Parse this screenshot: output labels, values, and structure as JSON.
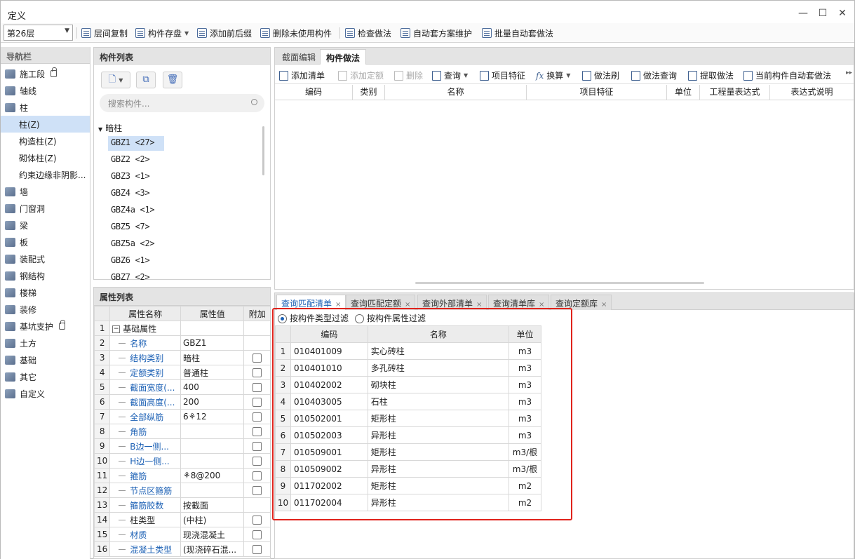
{
  "window": {
    "title": "定义"
  },
  "toolbar": {
    "floor": "第26层",
    "items": [
      {
        "label": "层间复制"
      },
      {
        "label": "构件存盘"
      },
      {
        "label": "添加前后缀"
      },
      {
        "label": "删除未使用构件"
      },
      {
        "label": "检查做法"
      },
      {
        "label": "自动套方案维护"
      },
      {
        "label": "批量自动套做法"
      }
    ]
  },
  "nav": {
    "title": "导航栏",
    "items": [
      {
        "label": "施工段",
        "icon": "construction-stage-icon"
      },
      {
        "label": "轴线",
        "icon": "axis-grid-icon"
      },
      {
        "label": "柱",
        "icon": "column-icon"
      },
      {
        "label": "柱(Z)",
        "sub": true
      },
      {
        "label": "构造柱(Z)",
        "sub": true
      },
      {
        "label": "砌体柱(Z)",
        "sub": true
      },
      {
        "label": "约束边缘非阴影...",
        "sub": true
      },
      {
        "label": "墙",
        "icon": "wall-icon"
      },
      {
        "label": "门窗洞",
        "icon": "door-window-icon"
      },
      {
        "label": "梁",
        "icon": "beam-icon"
      },
      {
        "label": "板",
        "icon": "slab-icon"
      },
      {
        "label": "装配式",
        "icon": "prefab-icon"
      },
      {
        "label": "钢结构",
        "icon": "steel-structure-icon"
      },
      {
        "label": "楼梯",
        "icon": "stairs-icon"
      },
      {
        "label": "装修",
        "icon": "decoration-icon"
      },
      {
        "label": "基坑支护",
        "icon": "foundation-pit-icon"
      },
      {
        "label": "土方",
        "icon": "earthwork-icon"
      },
      {
        "label": "基础",
        "icon": "foundation-icon"
      },
      {
        "label": "其它",
        "icon": "others-icon"
      },
      {
        "label": "自定义",
        "icon": "custom-icon"
      }
    ]
  },
  "components": {
    "title": "构件列表",
    "search_placeholder": "搜索构件...",
    "root": "暗柱",
    "items": [
      "GBZ1 <27>",
      "GBZ2 <2>",
      "GBZ3 <1>",
      "GBZ4 <3>",
      "GBZ4a <1>",
      "GBZ5 <7>",
      "GBZ5a <2>",
      "GBZ6 <1>",
      "GBZ7 <2>"
    ]
  },
  "properties": {
    "title": "属性列表",
    "headers": [
      "属性名称",
      "属性值",
      "附加"
    ],
    "rows": [
      {
        "n": "1",
        "name": "基础属性",
        "value": "",
        "group": true
      },
      {
        "n": "2",
        "name": "名称",
        "value": "GBZ1",
        "cb": false
      },
      {
        "n": "3",
        "name": "结构类别",
        "value": "暗柱",
        "cb": true
      },
      {
        "n": "4",
        "name": "定额类别",
        "value": "普通柱",
        "cb": true
      },
      {
        "n": "5",
        "name": "截面宽度(...",
        "value": "400",
        "cb": true
      },
      {
        "n": "6",
        "name": "截面高度(...",
        "value": "200",
        "cb": true
      },
      {
        "n": "7",
        "name": "全部纵筋",
        "value": "6⚘12",
        "cb": true
      },
      {
        "n": "8",
        "name": "角筋",
        "value": "",
        "cb": true
      },
      {
        "n": "9",
        "name": "B边一侧...",
        "value": "",
        "cb": true
      },
      {
        "n": "10",
        "name": "H边一侧...",
        "value": "",
        "cb": true
      },
      {
        "n": "11",
        "name": "箍筋",
        "value": "⚘8@200",
        "cb": true
      },
      {
        "n": "12",
        "name": "节点区箍筋",
        "value": "",
        "cb": true
      },
      {
        "n": "13",
        "name": "箍筋胶数",
        "value": "按截面",
        "cb": false
      },
      {
        "n": "14",
        "name": "柱类型",
        "value": "(中柱)",
        "cb": true,
        "black": true
      },
      {
        "n": "15",
        "name": "材质",
        "value": "现浇混凝土",
        "cb": true
      },
      {
        "n": "16",
        "name": "混凝土类型",
        "value": "(现浇碎石混...",
        "cb": true
      }
    ]
  },
  "method": {
    "tabs": [
      "截面编辑",
      "构件做法"
    ],
    "tools": [
      {
        "label": "添加清单",
        "disabled": false
      },
      {
        "label": "添加定额",
        "disabled": true
      },
      {
        "label": "删除",
        "disabled": true
      },
      {
        "label": "查询",
        "disabled": false
      },
      {
        "label": "项目特征",
        "disabled": false
      },
      {
        "label": "换算",
        "disabled": false
      },
      {
        "label": "做法刷",
        "disabled": false
      },
      {
        "label": "做法查询",
        "disabled": false
      },
      {
        "label": "提取做法",
        "disabled": false
      },
      {
        "label": "当前构件自动套做法",
        "disabled": false
      }
    ],
    "columns": [
      "编码",
      "类别",
      "名称",
      "项目特征",
      "单位",
      "工程量表达式",
      "表达式说明"
    ]
  },
  "query": {
    "tabs": [
      "查询匹配清单",
      "查询匹配定额",
      "查询外部清单",
      "查询清单库",
      "查询定额库"
    ],
    "filter_type": "按构件类型过滤",
    "filter_attr": "按构件属性过滤",
    "headers": [
      "编码",
      "名称",
      "单位"
    ],
    "rows": [
      {
        "n": "1",
        "code": "010401009",
        "name": "实心砖柱",
        "unit": "m3"
      },
      {
        "n": "2",
        "code": "010401010",
        "name": "多孔砖柱",
        "unit": "m3"
      },
      {
        "n": "3",
        "code": "010402002",
        "name": "砌块柱",
        "unit": "m3"
      },
      {
        "n": "4",
        "code": "010403005",
        "name": "石柱",
        "unit": "m3"
      },
      {
        "n": "5",
        "code": "010502001",
        "name": "矩形柱",
        "unit": "m3"
      },
      {
        "n": "6",
        "code": "010502003",
        "name": "异形柱",
        "unit": "m3"
      },
      {
        "n": "7",
        "code": "010509001",
        "name": "矩形柱",
        "unit": "m3/根"
      },
      {
        "n": "8",
        "code": "010509002",
        "name": "异形柱",
        "unit": "m3/根"
      },
      {
        "n": "9",
        "code": "011702002",
        "name": "矩形柱",
        "unit": "m2"
      },
      {
        "n": "10",
        "code": "011702004",
        "name": "异形柱",
        "unit": "m2"
      }
    ]
  }
}
